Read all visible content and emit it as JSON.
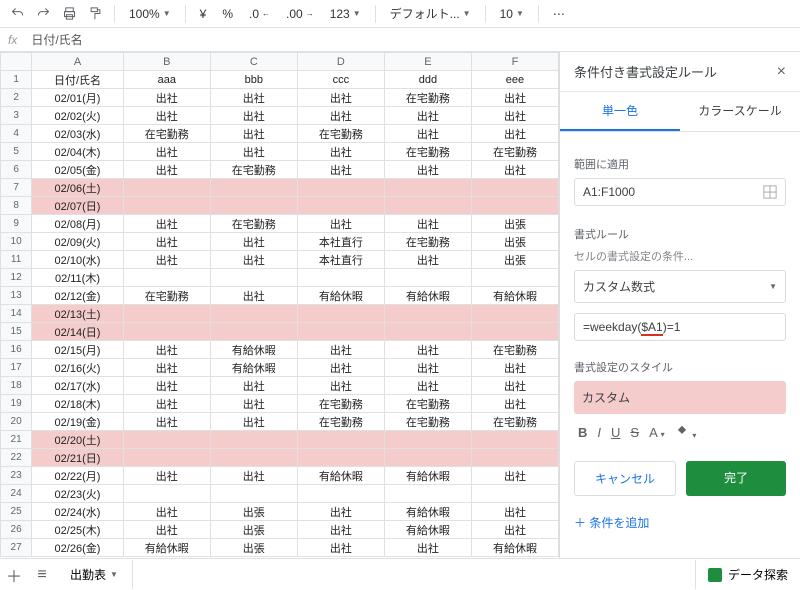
{
  "toolbar": {
    "zoom": "100%",
    "currency": "¥",
    "percent": "%",
    "dec_dec": ".0",
    "dec_inc": ".00",
    "num_fmt": "123",
    "font": "デフォルト...",
    "size": "10"
  },
  "fx": {
    "label": "fx",
    "value": "日付/氏名"
  },
  "columns": [
    "",
    "A",
    "B",
    "C",
    "D",
    "E",
    "F"
  ],
  "rows": [
    {
      "n": 1,
      "wk": false,
      "c": [
        "日付/氏名",
        "aaa",
        "bbb",
        "ccc",
        "ddd",
        "eee"
      ]
    },
    {
      "n": 2,
      "wk": false,
      "c": [
        "02/01(月)",
        "出社",
        "出社",
        "出社",
        "在宅勤務",
        "出社"
      ]
    },
    {
      "n": 3,
      "wk": false,
      "c": [
        "02/02(火)",
        "出社",
        "出社",
        "出社",
        "出社",
        "出社"
      ]
    },
    {
      "n": 4,
      "wk": false,
      "c": [
        "02/03(水)",
        "在宅勤務",
        "出社",
        "在宅勤務",
        "出社",
        "出社"
      ]
    },
    {
      "n": 5,
      "wk": false,
      "c": [
        "02/04(木)",
        "出社",
        "出社",
        "出社",
        "在宅勤務",
        "在宅勤務"
      ]
    },
    {
      "n": 6,
      "wk": false,
      "c": [
        "02/05(金)",
        "出社",
        "在宅勤務",
        "出社",
        "出社",
        "出社"
      ]
    },
    {
      "n": 7,
      "wk": true,
      "c": [
        "02/06(土)",
        "",
        "",
        "",
        "",
        ""
      ]
    },
    {
      "n": 8,
      "wk": true,
      "c": [
        "02/07(日)",
        "",
        "",
        "",
        "",
        ""
      ]
    },
    {
      "n": 9,
      "wk": false,
      "c": [
        "02/08(月)",
        "出社",
        "在宅勤務",
        "出社",
        "出社",
        "出張"
      ]
    },
    {
      "n": 10,
      "wk": false,
      "c": [
        "02/09(火)",
        "出社",
        "出社",
        "本社直行",
        "在宅勤務",
        "出張"
      ]
    },
    {
      "n": 11,
      "wk": false,
      "c": [
        "02/10(水)",
        "出社",
        "出社",
        "本社直行",
        "出社",
        "出張"
      ]
    },
    {
      "n": 12,
      "wk": false,
      "c": [
        "02/11(木)",
        "",
        "",
        "",
        "",
        ""
      ]
    },
    {
      "n": 13,
      "wk": false,
      "c": [
        "02/12(金)",
        "在宅勤務",
        "出社",
        "有給休暇",
        "有給休暇",
        "有給休暇"
      ]
    },
    {
      "n": 14,
      "wk": true,
      "c": [
        "02/13(土)",
        "",
        "",
        "",
        "",
        ""
      ]
    },
    {
      "n": 15,
      "wk": true,
      "c": [
        "02/14(日)",
        "",
        "",
        "",
        "",
        ""
      ]
    },
    {
      "n": 16,
      "wk": false,
      "c": [
        "02/15(月)",
        "出社",
        "有給休暇",
        "出社",
        "出社",
        "在宅勤務"
      ]
    },
    {
      "n": 17,
      "wk": false,
      "c": [
        "02/16(火)",
        "出社",
        "有給休暇",
        "出社",
        "出社",
        "出社"
      ]
    },
    {
      "n": 18,
      "wk": false,
      "c": [
        "02/17(水)",
        "出社",
        "出社",
        "出社",
        "出社",
        "出社"
      ]
    },
    {
      "n": 19,
      "wk": false,
      "c": [
        "02/18(木)",
        "出社",
        "出社",
        "在宅勤務",
        "在宅勤務",
        "出社"
      ]
    },
    {
      "n": 20,
      "wk": false,
      "c": [
        "02/19(金)",
        "出社",
        "出社",
        "在宅勤務",
        "在宅勤務",
        "在宅勤務"
      ]
    },
    {
      "n": 21,
      "wk": true,
      "c": [
        "02/20(土)",
        "",
        "",
        "",
        "",
        ""
      ]
    },
    {
      "n": 22,
      "wk": true,
      "c": [
        "02/21(日)",
        "",
        "",
        "",
        "",
        ""
      ]
    },
    {
      "n": 23,
      "wk": false,
      "c": [
        "02/22(月)",
        "出社",
        "出社",
        "有給休暇",
        "有給休暇",
        "出社"
      ]
    },
    {
      "n": 24,
      "wk": false,
      "c": [
        "02/23(火)",
        "",
        "",
        "",
        "",
        ""
      ]
    },
    {
      "n": 25,
      "wk": false,
      "c": [
        "02/24(水)",
        "出社",
        "出張",
        "出社",
        "有給休暇",
        "出社"
      ]
    },
    {
      "n": 26,
      "wk": false,
      "c": [
        "02/25(木)",
        "出社",
        "出張",
        "出社",
        "有給休暇",
        "出社"
      ]
    },
    {
      "n": 27,
      "wk": false,
      "c": [
        "02/26(金)",
        "有給休暇",
        "出張",
        "出社",
        "出社",
        "有給休暇"
      ]
    }
  ],
  "panel": {
    "title": "条件付き書式設定ルール",
    "tab1": "単一色",
    "tab2": "カラースケール",
    "range_label": "範囲に適用",
    "range": "A1:F1000",
    "rules_label": "書式ルール",
    "condition_label": "セルの書式設定の条件...",
    "condition": "カスタム数式",
    "formula_pre": "=weekday(",
    "formula_hl": "$A1",
    "formula_post": ")=1",
    "style_label": "書式設定のスタイル",
    "style_name": "カスタム",
    "fmt": {
      "b": "B",
      "i": "I",
      "u": "U",
      "s": "S",
      "a": "A"
    },
    "cancel": "キャンセル",
    "done": "完了",
    "add": "条件を追加"
  },
  "bottom": {
    "sheet": "出勤表",
    "explore": "データ探索"
  }
}
